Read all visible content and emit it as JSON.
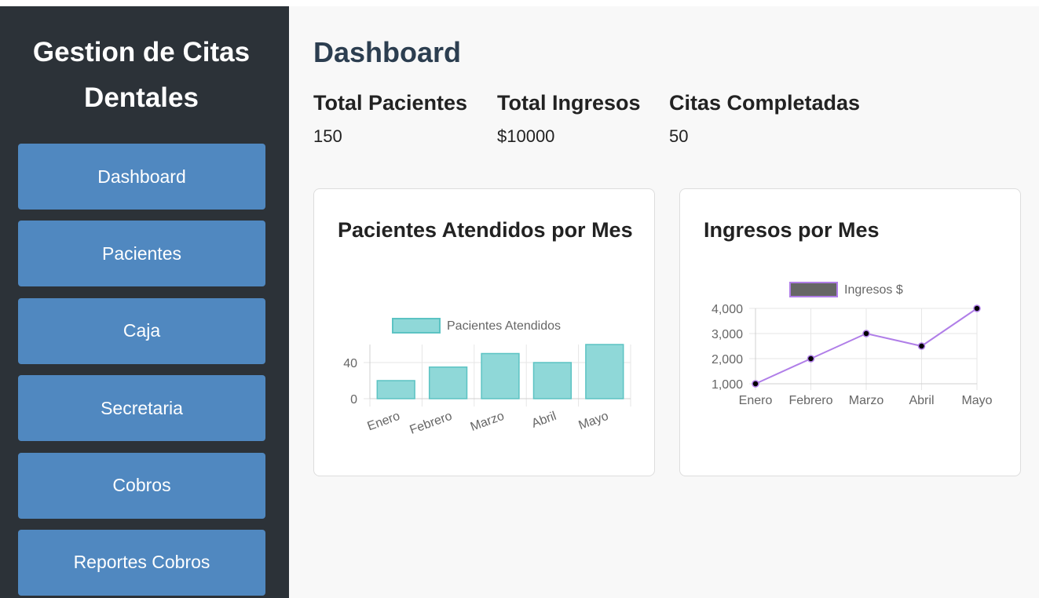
{
  "sidebar": {
    "title_line1": "Gestion de Citas",
    "title_line2": "Dentales",
    "items": [
      {
        "label": "Dashboard"
      },
      {
        "label": "Pacientes"
      },
      {
        "label": "Caja"
      },
      {
        "label": "Secretaria"
      },
      {
        "label": "Cobros"
      },
      {
        "label": "Reportes Cobros"
      }
    ]
  },
  "main": {
    "title": "Dashboard",
    "stats": [
      {
        "label": "Total Pacientes",
        "value": "150"
      },
      {
        "label": "Total Ingresos",
        "value": "$10000"
      },
      {
        "label": "Citas Completadas",
        "value": "50"
      }
    ]
  },
  "colors": {
    "sidebar_bg": "#2c3238",
    "nav_button": "#5088c0",
    "bar_fill": "#8fd8d8",
    "bar_stroke": "#5cc3c3",
    "line_stroke": "#b07ee8",
    "point_fill": "#000000"
  },
  "chart_data": [
    {
      "type": "bar",
      "title": "Pacientes Atendidos por Mes",
      "categories": [
        "Enero",
        "Febrero",
        "Marzo",
        "Abril",
        "Mayo"
      ],
      "series": [
        {
          "name": "Pacientes Atendidos",
          "values": [
            20,
            35,
            50,
            40,
            60
          ]
        }
      ],
      "yticks": [
        "0",
        "40"
      ],
      "ylim": [
        0,
        60
      ],
      "grid": true,
      "legend": "top"
    },
    {
      "type": "line",
      "title": "Ingresos por Mes",
      "categories": [
        "Enero",
        "Febrero",
        "Marzo",
        "Abril",
        "Mayo"
      ],
      "series": [
        {
          "name": "Ingresos $",
          "values": [
            1000,
            2000,
            3000,
            2500,
            4000
          ]
        }
      ],
      "yticks": [
        "1,000",
        "2,000",
        "3,000",
        "4,000"
      ],
      "ylim": [
        1000,
        4000
      ],
      "grid": true,
      "legend": "top"
    }
  ]
}
